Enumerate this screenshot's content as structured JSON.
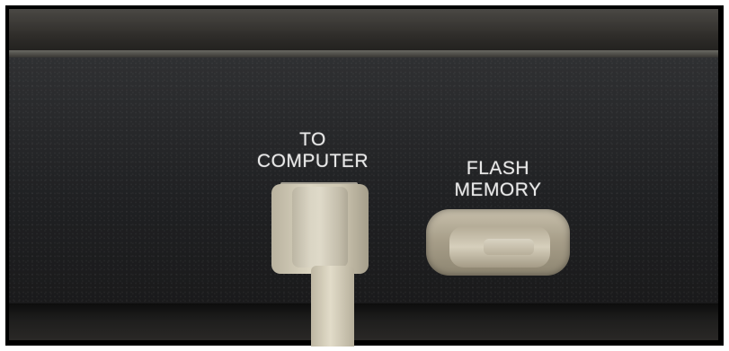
{
  "labels": {
    "to_computer_line1": "TO",
    "to_computer_line2": "COMPUTER",
    "flash_memory_line1": "FLASH",
    "flash_memory_line2": "MEMORY"
  },
  "icons": [
    "usb-plug-icon",
    "flash-drive-icon"
  ],
  "colors": {
    "panel": "#202123",
    "label_text": "#e8e8e8",
    "plug_beige": "#d5cfbb"
  }
}
